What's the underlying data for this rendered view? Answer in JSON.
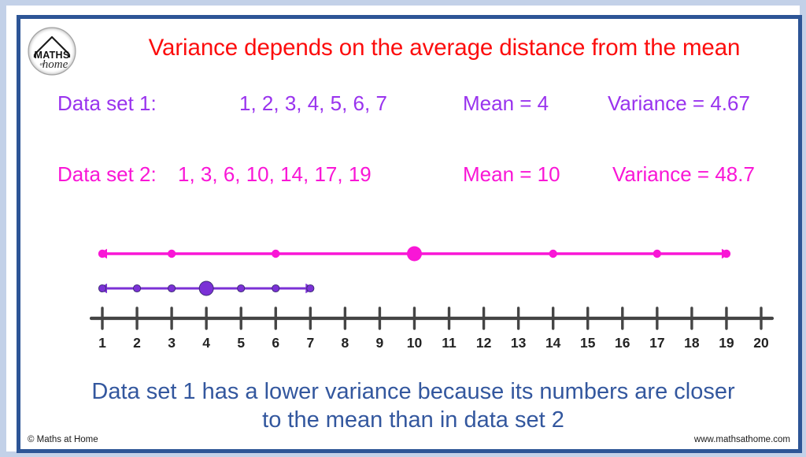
{
  "logo": {
    "top_text": "MATHS",
    "script_text": "home",
    "at_text": "at"
  },
  "title": "Variance depends on the average distance from the mean",
  "rows": [
    {
      "label": "Data set 1:",
      "values": "1, 2, 3, 4, 5, 6, 7",
      "mean": "Mean = 4",
      "variance": "Variance = 4.67",
      "color": "#9933ee"
    },
    {
      "label": "Data set 2:",
      "values": "1, 3, 6, 10, 14, 17, 19",
      "mean": "Mean = 10",
      "variance": "Variance = 48.7",
      "color": "#f916d6"
    }
  ],
  "caption_line1": "Data set 1 has a lower variance because its numbers are closer",
  "caption_line2": "to the mean than in data set 2",
  "footer": {
    "left": "© Maths at Home",
    "right": "www.mathsathome.com"
  },
  "chart_data": {
    "type": "scatter",
    "title": "Variance depends on the average distance from the mean",
    "xlabel": "",
    "ylabel": "",
    "xlim": [
      1,
      20
    ],
    "grid": false,
    "axis_ticks": [
      1,
      2,
      3,
      4,
      5,
      6,
      7,
      8,
      9,
      10,
      11,
      12,
      13,
      14,
      15,
      16,
      17,
      18,
      19,
      20
    ],
    "axis_color": "#454545",
    "legend": "none",
    "series": [
      {
        "name": "Data set 2",
        "color": "#f916d6",
        "values": [
          1,
          3,
          6,
          10,
          14,
          17,
          19
        ],
        "mean": 10,
        "variance": 48.7,
        "row": "upper",
        "arrows": "both-outward-from-mean"
      },
      {
        "name": "Data set 1",
        "color": "#7b31d6",
        "values": [
          1,
          2,
          3,
          4,
          5,
          6,
          7
        ],
        "mean": 4,
        "variance": 4.67,
        "row": "lower",
        "arrows": "both-outward-from-mean"
      }
    ]
  }
}
